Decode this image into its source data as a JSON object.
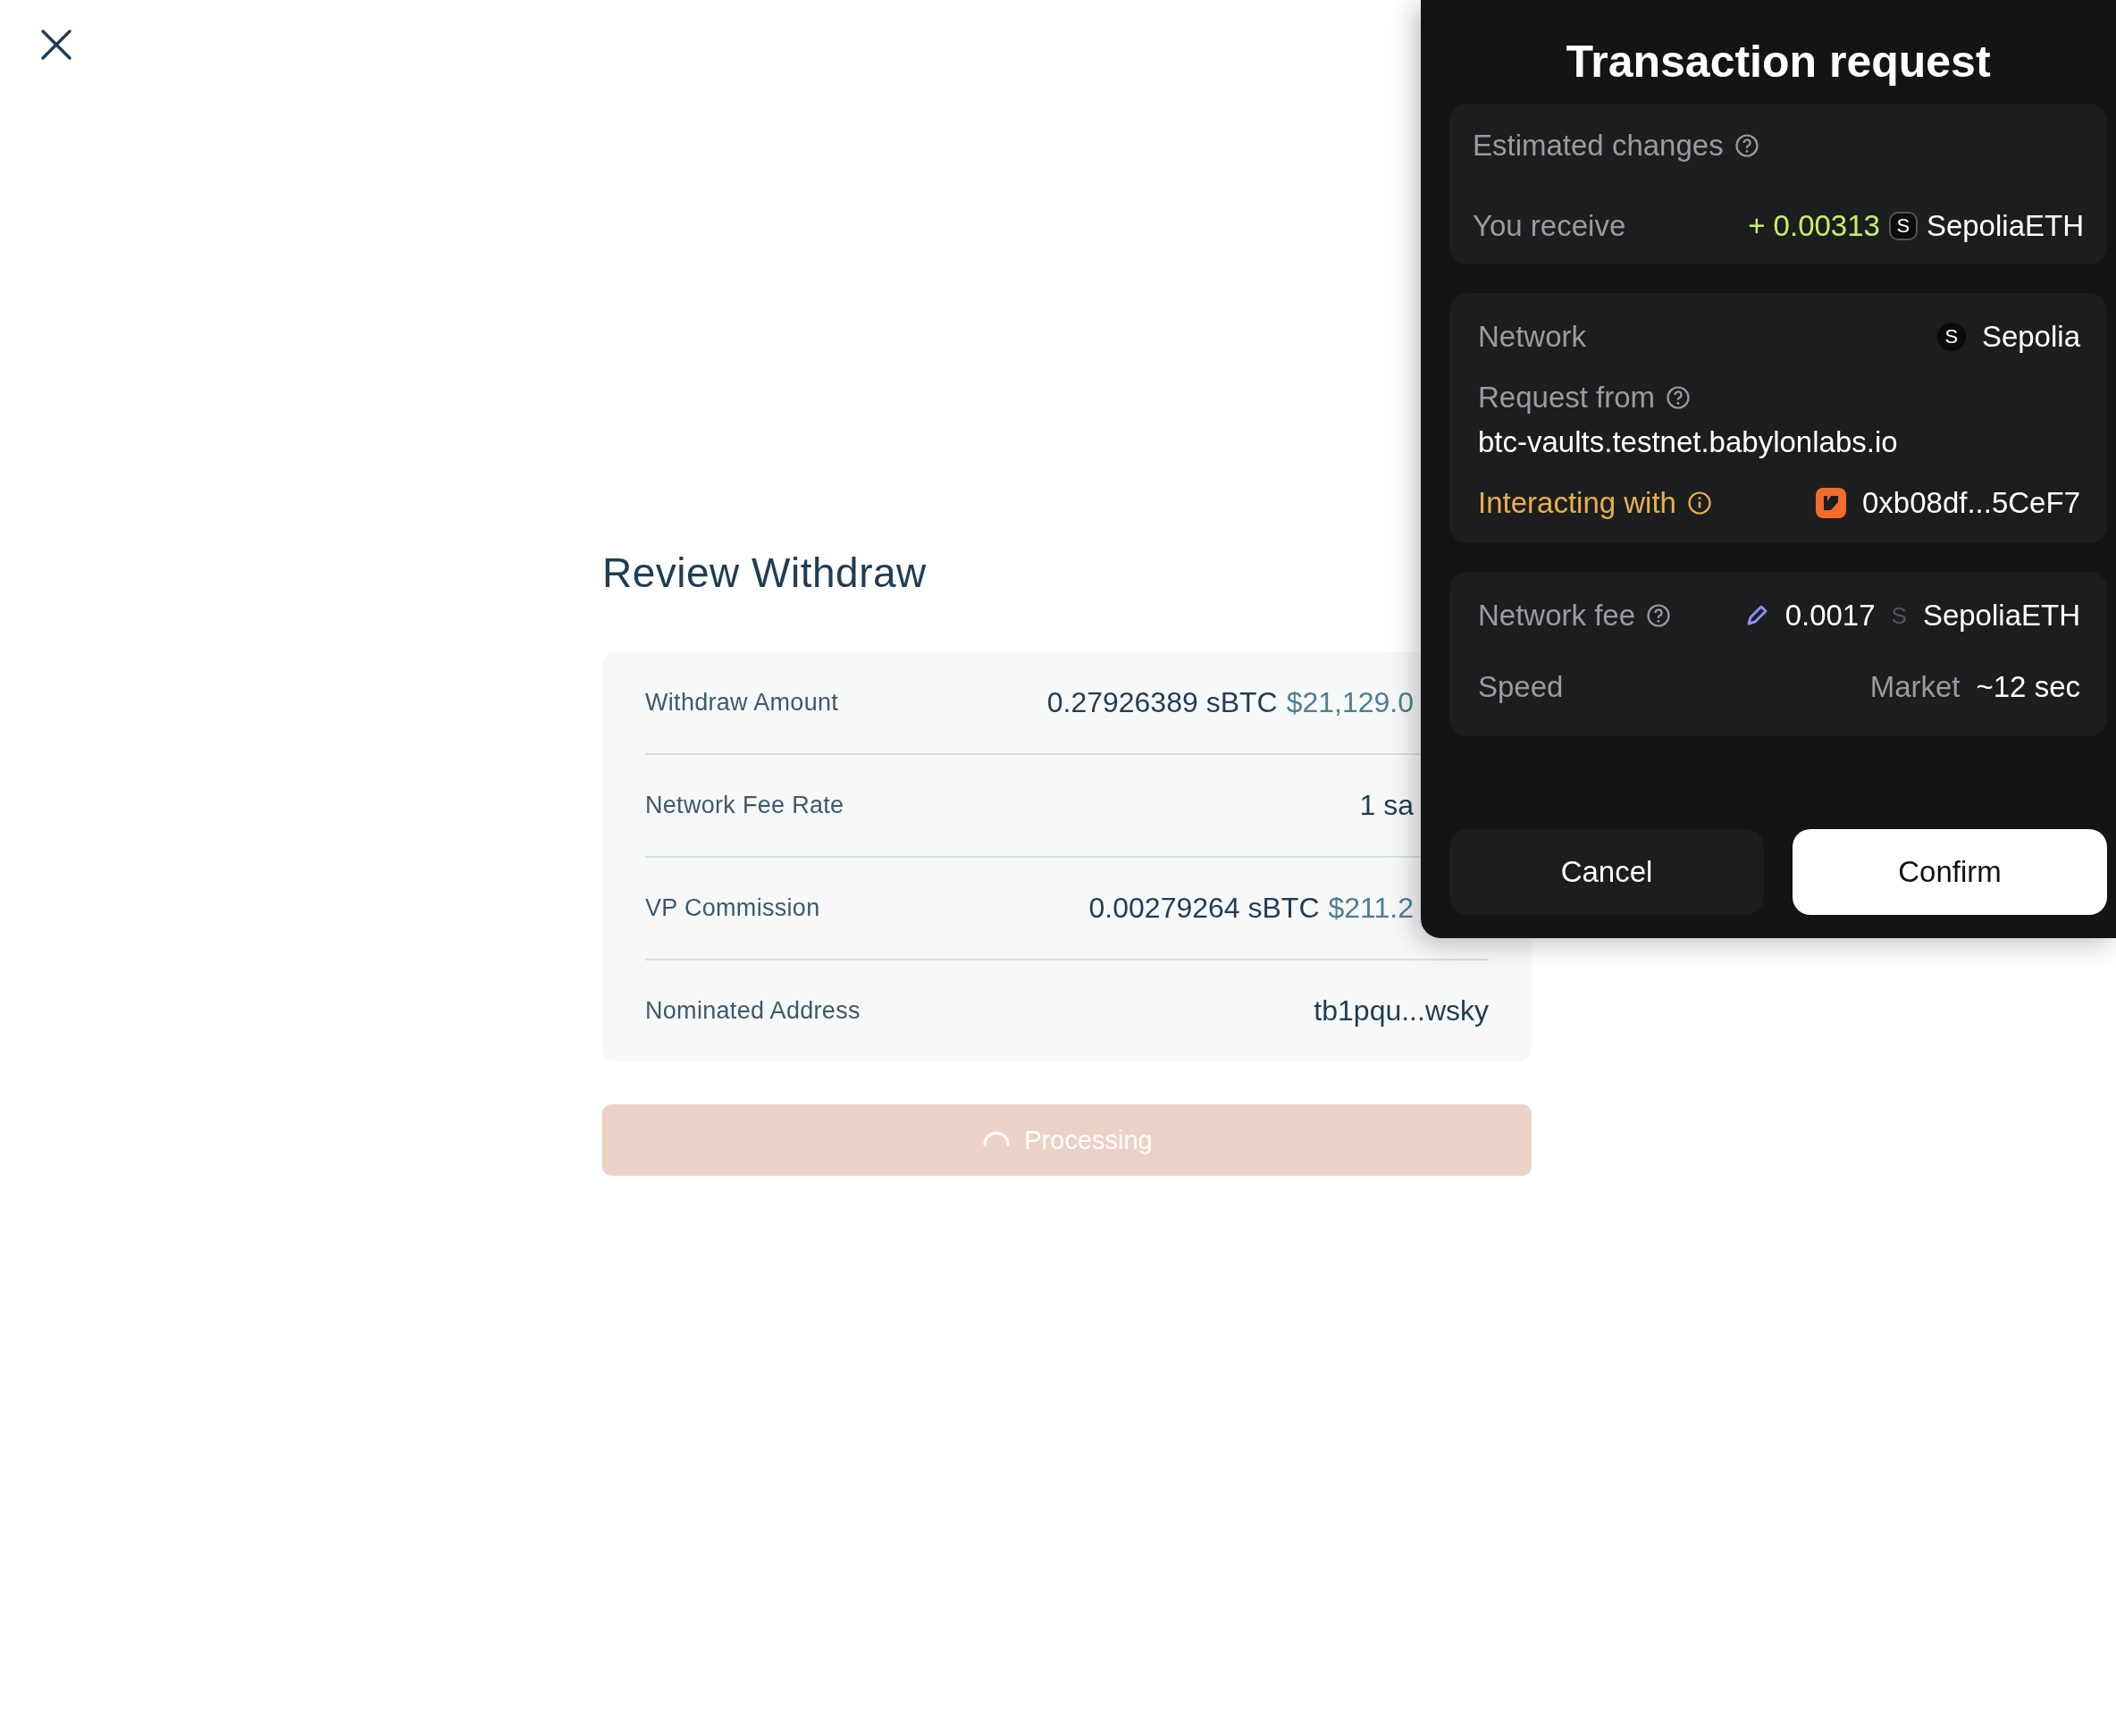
{
  "review": {
    "title": "Review Withdraw",
    "rows": [
      {
        "label": "Withdraw Amount",
        "value": "0.27926389 sBTC",
        "fiat": "$21,129.0",
        "cut_off": true
      },
      {
        "label": "Network Fee Rate",
        "value": "1 sa",
        "cut_off": true
      },
      {
        "label": "VP Commission",
        "value": "0.00279264 sBTC",
        "fiat": "$211.2",
        "cut_off": true
      },
      {
        "label": "Nominated Address",
        "value": "tb1pqu...wsky",
        "cut_off": false
      }
    ],
    "submit": {
      "label": "Processing",
      "busy": true
    }
  },
  "dialog": {
    "title": "Transaction request",
    "estimated_changes": {
      "heading": "Estimated changes",
      "label": "You receive",
      "amount": "+ 0.00313",
      "token_icon": "S",
      "token": "SepoliaETH"
    },
    "details": {
      "network_label": "Network",
      "network_icon": "S",
      "network": "Sepolia",
      "request_from_label": "Request from",
      "origin": "btc-vaults.testnet.babylonlabs.io",
      "interacting_label": "Interacting with",
      "contract": "0xb08df...5CeF7"
    },
    "fee": {
      "label": "Network fee",
      "amount": "0.0017",
      "token_icon": "S",
      "token": "SepoliaETH",
      "speed_label": "Speed",
      "speed": "Market",
      "time": "~12 sec"
    },
    "buttons": [
      {
        "label": "Cancel",
        "kind": "secondary"
      },
      {
        "label": "Confirm",
        "kind": "primary"
      }
    ]
  }
}
